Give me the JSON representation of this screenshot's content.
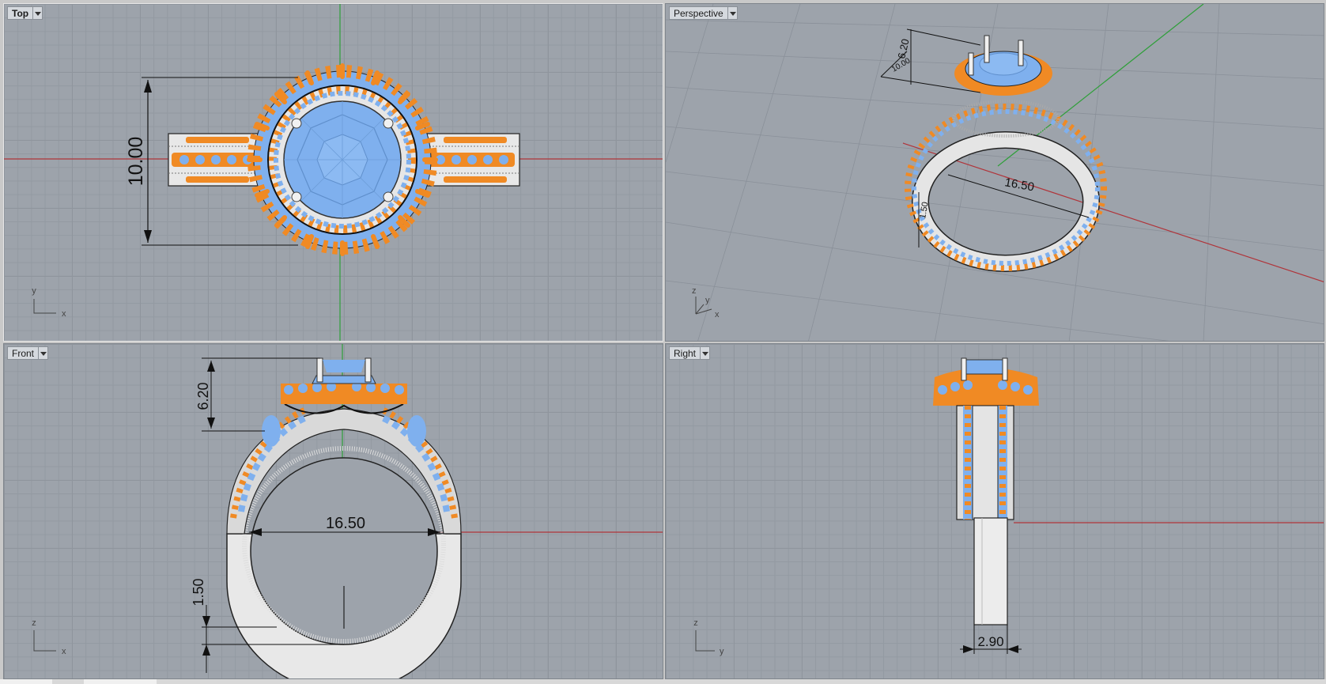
{
  "viewports": {
    "top": {
      "label": "Top",
      "dim_width": "10.00",
      "axis_v": "y",
      "axis_h": "x"
    },
    "perspective": {
      "label": "Perspective",
      "dim_a": "10.00",
      "dim_b": "6.20",
      "dim_c": "16.50",
      "dim_d": "1.50",
      "axis_z": "z",
      "axis_y": "y",
      "axis_x": "x"
    },
    "front": {
      "label": "Front",
      "dim_height": "6.20",
      "dim_inner": "16.50",
      "dim_band": "1.50",
      "axis_v": "z",
      "axis_h": "x"
    },
    "right": {
      "label": "Right",
      "dim_width": "2.90",
      "axis_v": "z",
      "axis_h": "y"
    }
  },
  "colors": {
    "gem": "#7fb0ee",
    "side_stone": "#f08a24",
    "metal": "#ececec",
    "x_axis": "#b0343a",
    "y_axis": "#2f9f3a"
  }
}
